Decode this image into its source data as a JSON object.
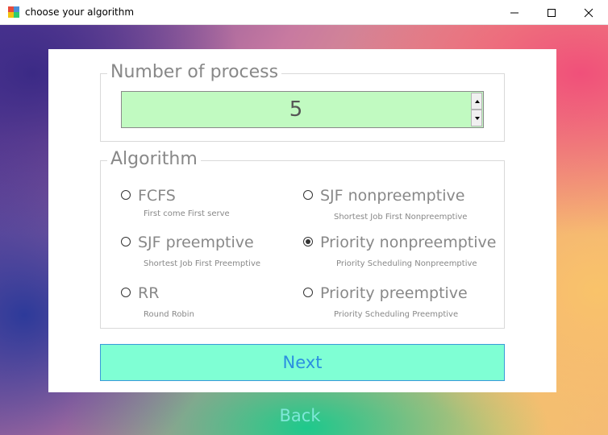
{
  "window": {
    "title": "choose your algorithm",
    "app_icon": "winforms-app-icon",
    "controls": [
      "minimize-icon",
      "maximize-icon",
      "close-icon"
    ]
  },
  "process_group": {
    "legend": "Number of process",
    "value": "5",
    "value_bg": "#c1fac1"
  },
  "algorithm_group": {
    "legend": "Algorithm",
    "options": [
      {
        "label": "FCFS",
        "sub": "First come First serve",
        "selected": false
      },
      {
        "label": "SJF nonpreemptive",
        "sub": "Shortest Job First Nonpreemptive",
        "selected": false
      },
      {
        "label": "SJF preemptive",
        "sub": "Shortest Job First Preemptive",
        "selected": false
      },
      {
        "label": "Priority nonpreemptive",
        "sub": "Priority Scheduling Nonpreemptive",
        "selected": true
      },
      {
        "label": "RR",
        "sub": "Round Robin",
        "selected": false
      },
      {
        "label": "Priority preemptive",
        "sub": "Priority Scheduling Preemptive",
        "selected": false
      }
    ]
  },
  "buttons": {
    "next": "Next",
    "back": "Back"
  },
  "colors": {
    "next_bg": "#7fffd4",
    "next_text": "#2b8fe0",
    "back_text": "#7fe8d8",
    "label_text": "#888888"
  }
}
